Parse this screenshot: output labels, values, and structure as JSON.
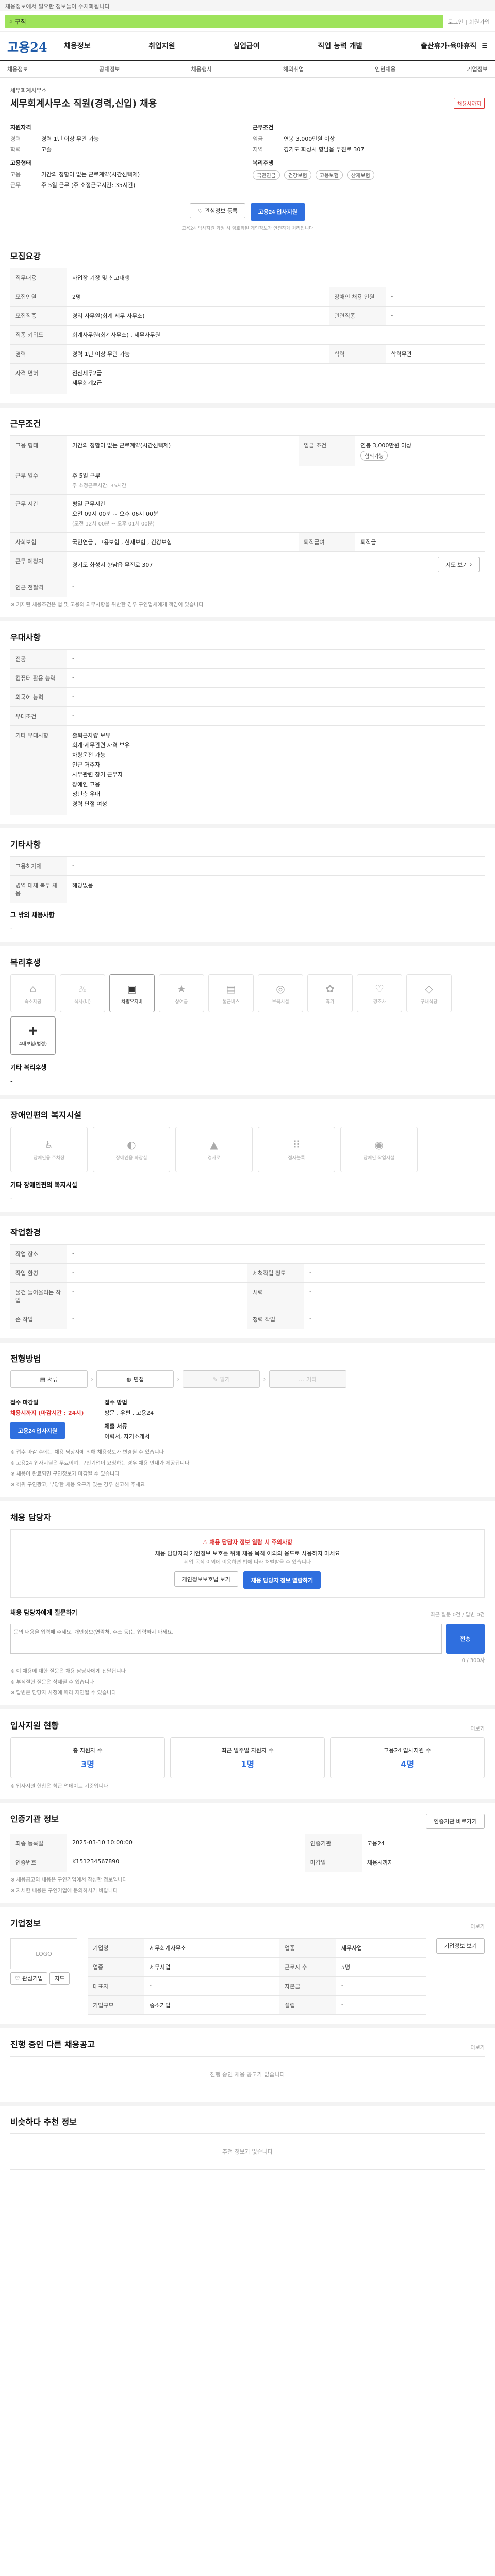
{
  "top": {
    "notice": "채용정보에서 필요한 정보들이 수치화됩니다",
    "search_text": "구직",
    "right_text": "로그인 | 회원가입"
  },
  "gnb": {
    "logo": "고용24",
    "menu": [
      "채용정보",
      "취업지원",
      "실업급여",
      "직업 능력 개발",
      "출산휴가·육아휴직"
    ]
  },
  "lnb": [
    "채용정보",
    "공채정보",
    "채용행사",
    "해외취업",
    "인턴채용",
    "기업정보"
  ],
  "job": {
    "company": "세무회계사무소",
    "title": "세무회계사무소 직원(경력,신입) 채용",
    "badge": "채용시까지",
    "summary_left_title": "지원자격",
    "left": [
      {
        "k": "경력",
        "v": "경력 1년 이상 무관 가능"
      },
      {
        "k": "학력",
        "v": "고졸"
      }
    ],
    "emp_title": "고용형태",
    "emp": [
      {
        "k": "고용",
        "v": "기간의 정함이 없는 근로계약(시간선택제)"
      },
      {
        "k": "근무",
        "v": "주 5일 근무 (주 소정근로시간: 35시간)"
      }
    ],
    "summary_right_title": "근무조건",
    "right": [
      {
        "k": "임금",
        "v": "연봉 3,000만원 이상"
      },
      {
        "k": "지역",
        "v": "경기도 화성시 향남읍 무진로 307"
      }
    ],
    "welfare_title": "복리후생",
    "welfare": [
      "국민연금",
      "건강보험",
      "고용보험",
      "산재보험"
    ],
    "btn_save": "관심정보 등록",
    "btn_apply": "고용24 입사지원",
    "note": "고용24 입사지원 과정 시 암호화된 개인정보가 안전하게 처리됩니다"
  },
  "recruit": {
    "title": "모집요강",
    "duty_label": "직무내용",
    "duty": "사업장 기장 및 신고대행",
    "rows": [
      {
        "k": "모집인원",
        "v": "2명",
        "k2": "장애인 채용 인원",
        "v2": "-"
      },
      {
        "k": "모집직종",
        "v": "경리 사무원(회계 세무 사무소)",
        "k2": "관련직종",
        "v2": "-"
      },
      {
        "k": "직종 키워드",
        "v": "회계사무원(회계사무소) , 세무사무원",
        "k2": "",
        "v2": ""
      },
      {
        "k": "경력",
        "v": "경력 1년 이상 무관 가능",
        "k2": "학력",
        "v2": "학력무관"
      },
      {
        "k": "자격 면허",
        "v": "전산세무2급",
        "k2": "",
        "v2": ""
      }
    ],
    "license_extra": "세무회계2급"
  },
  "work": {
    "title": "근무조건",
    "emp_type": "기간의 정함이 없는 근로계약(시간선택제)",
    "wage": "연봉 3,000만원 이상",
    "wage_tag": "협의가능",
    "work_time": "주 5일 근무",
    "hours": "주 소정근로시간: 35시간",
    "work_time2_title": "평일 근무시간",
    "work_time2": "오전 09시 00분 ~ 오후 06시 00분",
    "lunch": "(오전 12시 00분 ~ 오후 01시 00분)",
    "insurance": "국민연금 , 고용보험 , 산재보험 , 건강보험",
    "retire": "퇴직금",
    "location": "경기도 화성시 향남읍 무진로 307",
    "map_btn": "지도 보기",
    "near": "-",
    "note": "※ 기재된 채용조건은 법 및 고용의 의무사항을 위반한 경우 구인업체에게 책임이 있습니다"
  },
  "prefer": {
    "title": "우대사항",
    "rows": [
      {
        "k": "전공",
        "v": "-"
      },
      {
        "k": "컴퓨터 활용 능력",
        "v": "-"
      },
      {
        "k": "외국어 능력",
        "v": "-"
      },
      {
        "k": "우대조건",
        "v": "-"
      }
    ],
    "etc_title": "기타 우대사항",
    "etc": [
      "출퇴근차량 보유",
      "회계·세무관련 자격 보유",
      "차량운전 가능",
      "인근 거주자",
      "사무관련 장기 근무자",
      "장애인 고용",
      "청년층 우대",
      "경력 단절 여성"
    ]
  },
  "other": {
    "title": "기타사항",
    "rows": [
      {
        "k": "고용허가제",
        "v": "-"
      },
      {
        "k": "병역 대체 복무 채용",
        "v": "해당없음"
      }
    ],
    "extra_title": "그 밖의 채용사항",
    "extra": "-"
  },
  "welfare": {
    "title": "복리후생",
    "icons": [
      {
        "name": "lodging-icon",
        "g": "⌂",
        "label": "숙소제공",
        "on": false
      },
      {
        "name": "meal-icon",
        "g": "♨",
        "label": "식사(비)",
        "on": false
      },
      {
        "name": "car-icon",
        "g": "▣",
        "label": "차량유지비",
        "on": true
      },
      {
        "name": "bonus-icon",
        "g": "★",
        "label": "상여금",
        "on": false
      },
      {
        "name": "bus-icon",
        "g": "▤",
        "label": "통근버스",
        "on": false
      },
      {
        "name": "childcare-icon",
        "g": "◎",
        "label": "보육시설",
        "on": false
      },
      {
        "name": "holiday-icon",
        "g": "✿",
        "label": "휴가",
        "on": false
      },
      {
        "name": "wedding-icon",
        "g": "♡",
        "label": "경조사",
        "on": false
      },
      {
        "name": "cafeteria-icon",
        "g": "◇",
        "label": "구내식당",
        "on": false
      },
      {
        "name": "fourins-icon",
        "g": "✚",
        "label": "4대보험(법정)",
        "on": true
      }
    ],
    "extra_title": "기타 복리후생",
    "extra": "-"
  },
  "facility": {
    "title": "장애인편의 복지시설",
    "items": [
      {
        "name": "ramp-icon",
        "g": "♿",
        "label": "장애인용 주차장"
      },
      {
        "name": "toilet-icon",
        "g": "◐",
        "label": "장애인용 화장실"
      },
      {
        "name": "elevator-icon",
        "g": "▲",
        "label": "경사로"
      },
      {
        "name": "braille-icon",
        "g": "⠿",
        "label": "점자블록"
      },
      {
        "name": "wheel-icon",
        "g": "◉",
        "label": "장애인 작업시설"
      }
    ],
    "extra_title": "기타 장애인편의 복지시설",
    "extra": "-"
  },
  "environment": {
    "title": "작업환경",
    "rows": [
      {
        "k": "작업 장소",
        "v": "-",
        "k2": "",
        "v2": ""
      },
      {
        "k": "작업 환경",
        "v": "-",
        "k2": "세척작업 정도",
        "v2": "-"
      },
      {
        "k": "물건 들어올리는 작업",
        "v": "-",
        "k2": "시력",
        "v2": "-"
      },
      {
        "k": "손 작업",
        "v": "-",
        "k2": "청력 작업",
        "v2": "-"
      }
    ]
  },
  "process": {
    "title": "전형방법",
    "steps": [
      {
        "name": "doc-step",
        "label": "서류",
        "off": false
      },
      {
        "name": "interview-step",
        "label": "면접",
        "off": false
      },
      {
        "name": "test-step",
        "label": "필기",
        "off": true
      },
      {
        "name": "etc-step",
        "label": "기타",
        "off": true
      }
    ],
    "deadline_head": "접수 마감일",
    "deadline": "채용시까지 (마감시간 : 24시)",
    "method_head": "접수 방법",
    "method": "방문 , 우편 , 고용24",
    "apply_btn": "고용24 입사지원",
    "docs_head": "제출 서류",
    "docs": "이력서, 자기소개서",
    "notes": [
      "※ 접수 마감 후에는 채용 담당자에 의해 채용정보가 변경될 수 있습니다",
      "※ 고용24 입사지원은 무료이며, 구인기업이 요청하는 경우 채용 안내가 제공됩니다",
      "※ 채용이 완료되면 구인정보가 마감될 수 있습니다",
      "※ 허위 구인광고, 부당한 채용 요구가 있는 경우 신고해 주세요"
    ]
  },
  "contact": {
    "title": "채용 담당자",
    "warn_title": "채용 담당자 정보 열람 시 주의사항",
    "warn_desc": "채용 담당자의 개인정보 보호를 위해 채용 목적 이외의 용도로 사용하지 마세요",
    "warn_sub": "취업 목적 이외에 이용하면 법에 따라 처벌받을 수 있습니다",
    "btn_login": "개인정보보호법 보기",
    "btn_view": "채용 담당자 정보 열람하기",
    "q_title": "채용 담당자에게 질문하기",
    "q_count": "최근 질문 0건 / 답변 0건",
    "q_placeholder": "문의 내용을 입력해 주세요. 개인정보(연락처, 주소 등)는 입력하지 마세요.",
    "q_btn": "전송",
    "q_limit": "0 / 300자",
    "q_notes": [
      "※ 이 채용에 대한 질문은 채용 담당자에게 전달됩니다",
      "※ 부적절한 질문은 삭제될 수 있습니다",
      "※ 답변은 담당자 사정에 따라 지연될 수 있습니다"
    ]
  },
  "stats": {
    "title": "입사지원 현황",
    "more": "더보기",
    "items": [
      {
        "label": "총 지원자 수",
        "n": "3명"
      },
      {
        "label": "최근 일주일 지원자 수",
        "n": "1명"
      },
      {
        "label": "고용24 입사지원 수",
        "n": "4명"
      }
    ],
    "note": "※ 입사지원 현황은 최근 업데이트 기준입니다"
  },
  "info": {
    "title": "인증기관 정보",
    "btn": "인증기관 바로가기",
    "rows": [
      {
        "k": "최종 등록일",
        "v": "2025-03-10 10:00:00",
        "k2": "인증기관",
        "v2": "고용24"
      },
      {
        "k": "인증번호",
        "v": "K151234567890",
        "k2": "마감일",
        "v2": "채용시까지"
      }
    ],
    "notes": [
      "※ 채용공고의 내용은 구인기업에서 작성한 정보입니다",
      "※ 자세한 내용은 구인기업에 문의하시기 바랍니다"
    ]
  },
  "company": {
    "title": "기업정보",
    "more": "더보기",
    "logo_text": "LOGO",
    "rows": [
      {
        "k": "기업명",
        "v": "세무회계사무소",
        "k2": "업종",
        "v2": "세무사업"
      },
      {
        "k": "업종",
        "v": "세무사업",
        "k2": "근로자 수",
        "v2": "5명"
      },
      {
        "k": "대표자",
        "v": "-",
        "k2": "자본금",
        "v2": "-"
      },
      {
        "k": "기업규모",
        "v": "중소기업",
        "k2": "설립",
        "v2": "-"
      }
    ],
    "btn_info": "기업정보 보기",
    "btn_fav": "관심기업",
    "btn_map": "지도"
  },
  "recent": {
    "title": "진행 중인 다른 채용공고",
    "more": "더보기",
    "empty": "진행 중인 채용 공고가 없습니다"
  },
  "similar": {
    "title": "비슷하다 추천 정보",
    "empty": "추천 정보가 없습니다"
  }
}
